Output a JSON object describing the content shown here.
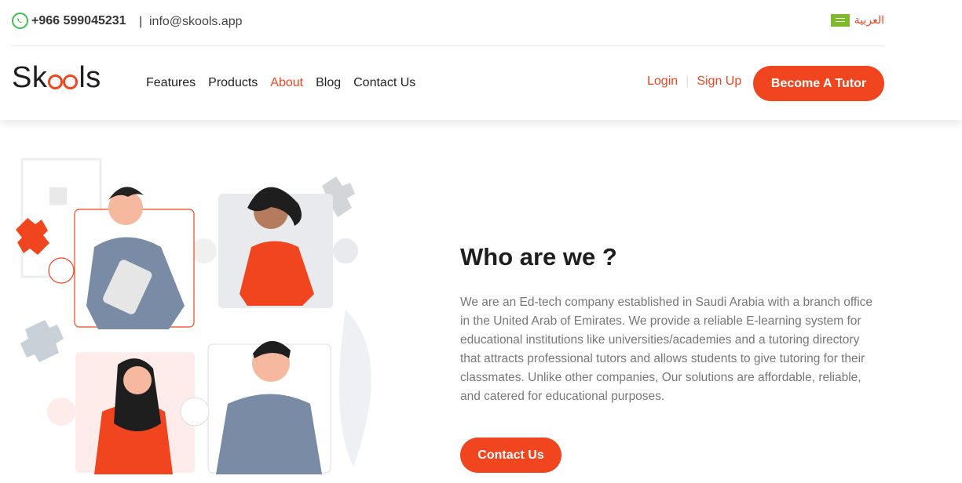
{
  "topbar": {
    "phone": "+966 599045231",
    "separator": "|",
    "email": "info@skools.app",
    "language": "العربية"
  },
  "brand": {
    "logo_start": "Sk",
    "logo_end": "ls"
  },
  "nav": {
    "items": [
      {
        "label": "Features"
      },
      {
        "label": "Products"
      },
      {
        "label": "About"
      },
      {
        "label": "Blog"
      },
      {
        "label": "Contact Us"
      }
    ],
    "active": "About"
  },
  "auth": {
    "login": "Login",
    "separator": "|",
    "signup": "Sign Up"
  },
  "cta": {
    "become_tutor": "Become A Tutor",
    "contact_us": "Contact Us"
  },
  "about": {
    "title": "Who are we ?",
    "body": "We are an Ed-tech company established in Saudi Arabia with a branch office in the United Arab of Emirates. We provide a reliable E-learning system for educational institutions like universities/academies and a tutoring directory that attracts professional tutors and allows students to give tutoring for their classmates. Unlike other companies, Our solutions are affordable, reliable, and catered for educational purposes."
  },
  "colors": {
    "accent": "#f0451e",
    "whatsapp": "#3cc04a",
    "flag": "#7dba2c"
  }
}
